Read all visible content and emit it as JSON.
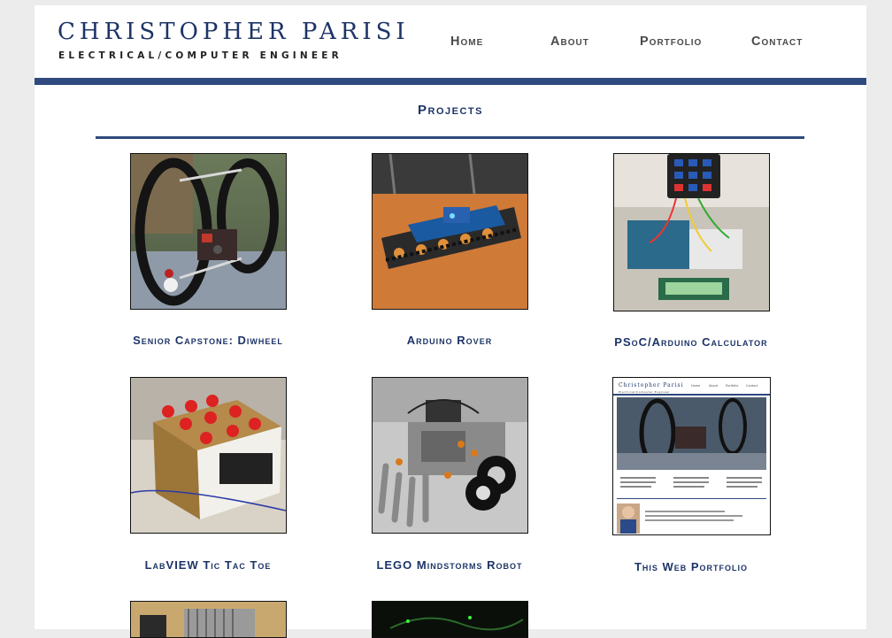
{
  "header": {
    "title": "Christopher Parisi",
    "subtitle": "Electrical/Computer Engineer"
  },
  "nav": {
    "home": "Home",
    "about": "About",
    "portfolio": "Portfolio",
    "contact": "Contact"
  },
  "section": {
    "title": "Projects"
  },
  "projects": [
    {
      "caption": "Senior Capstone: Diwheel",
      "thumbnail": "diwheel-photo"
    },
    {
      "caption": "Arduino Rover",
      "thumbnail": "rover-photo"
    },
    {
      "caption": "PSoC/Arduino Calculator",
      "thumbnail": "calculator-photo"
    },
    {
      "caption": "LabVIEW Tic Tac Toe",
      "thumbnail": "tic-tac-toe-photo"
    },
    {
      "caption": "LEGO Mindstorms Robot",
      "thumbnail": "lego-robot-photo"
    },
    {
      "caption": "This Web Portfolio",
      "thumbnail": "web-portfolio-screenshot"
    }
  ],
  "portfolio_preview": {
    "title": "Christopher Parisi",
    "subtitle": "Electrical/Computer Engineer",
    "nav": [
      "Home",
      "About",
      "Portfolio",
      "Contact"
    ]
  },
  "colors": {
    "brand_navy": "#1d3468",
    "rule_blue": "#2e4a7e",
    "nav_gray": "#4a4a4a",
    "page_background": "#ececec"
  }
}
